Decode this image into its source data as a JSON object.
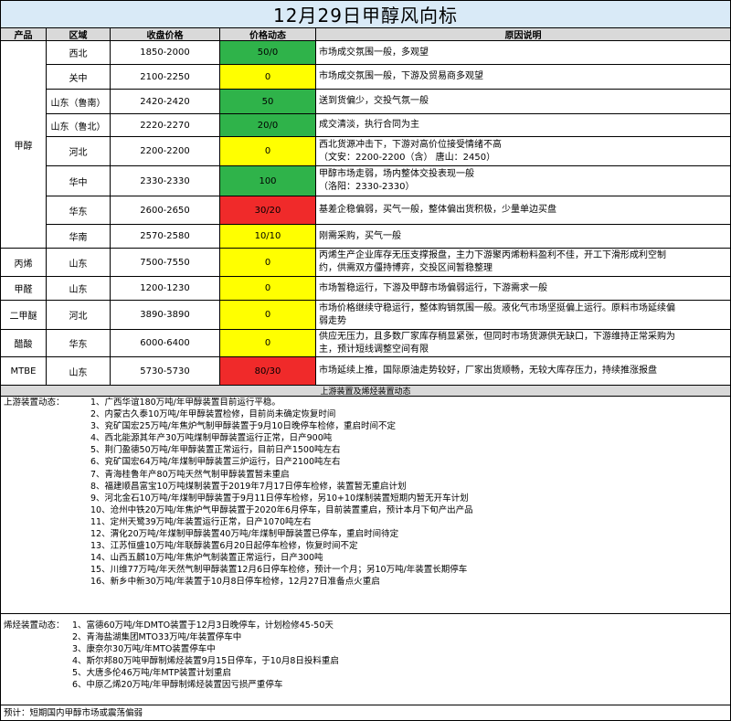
{
  "title": "12月29日甲醇风向标",
  "columns": [
    "产品",
    "区域",
    "收盘价格",
    "价格动态",
    "原因说明"
  ],
  "colors": {
    "up": "#2fb34a",
    "flat": "#ffff00",
    "down": "#f02a2a"
  },
  "rows": [
    {
      "product": "甲醇",
      "region": "西北",
      "price": "1850-2000",
      "change": "50/0",
      "status": "green",
      "reason": [
        "市场成交氛围一般，多观望"
      ]
    },
    {
      "product": "",
      "region": "关中",
      "price": "2100-2250",
      "change": "0",
      "status": "yellow",
      "reason": [
        "市场成交氛围一般，下游及贸易商多观望"
      ]
    },
    {
      "product": "",
      "region": "山东（鲁南）",
      "price": "2420-2420",
      "change": "50",
      "status": "green",
      "reason": [
        "送到货偏少，交投气氛一般"
      ]
    },
    {
      "product": "",
      "region": "山东（鲁北）",
      "price": "2220-2270",
      "change": "20/0",
      "status": "green",
      "reason": [
        "成交清淡，执行合同为主"
      ]
    },
    {
      "product": "",
      "region": "河北",
      "price": "2200-2200",
      "change": "0",
      "status": "yellow",
      "reason": [
        "西北货源冲击下，下游对高价位接受情绪不高",
        "（文安：2200-2200（含） 唐山：2450）"
      ]
    },
    {
      "product": "",
      "region": "华中",
      "price": "2330-2330",
      "change": "100",
      "status": "green",
      "reason": [
        "甲醇市场走弱，场内整体交投表现一般",
        "（洛阳：2330-2330）"
      ]
    },
    {
      "product": "",
      "region": "华东",
      "price": "2600-2650",
      "change": "30/20",
      "status": "red",
      "reason": [
        "基差企稳偏弱，买气一般，整体偏出货积极，少量单边买盘"
      ]
    },
    {
      "product": "",
      "region": "华南",
      "price": "2570-2580",
      "change": "10/10",
      "status": "yellow",
      "reason": [
        "刚需采购，买气一般"
      ]
    },
    {
      "product": "丙烯",
      "region": "山东",
      "price": "7500-7550",
      "change": "0",
      "status": "yellow",
      "reason": [
        "丙烯生产企业库存无压支撑报盘，主力下游聚丙烯粉料盈利不佳，开工下滑形成利空制",
        "约，供需双方僵持博弈，交投区间暂稳整理"
      ]
    },
    {
      "product": "甲醛",
      "region": "山东",
      "price": "1200-1230",
      "change": "0",
      "status": "yellow",
      "reason": [
        "市场暂稳运行，下游及甲醇市场偏弱运行，下游需求一般"
      ]
    },
    {
      "product": "二甲醚",
      "region": "河北",
      "price": "3890-3890",
      "change": "0",
      "status": "yellow",
      "reason": [
        "市场价格继续守稳运行，整体购销氛围一般。液化气市场坚挺偏上运行。原料市场延续偏",
        "弱走势"
      ]
    },
    {
      "product": "醋酸",
      "region": "华东",
      "price": "6000-6400",
      "change": "0",
      "status": "yellow",
      "reason": [
        "供应无压力，且多数厂家库存稍显紧张，但同时市场货源供无缺口，下游维持正常采购为",
        "主，预计短线调整空间有限"
      ]
    },
    {
      "product": "MTBE",
      "region": "山东",
      "price": "5730-5730",
      "change": "80/30",
      "status": "red",
      "reason": [
        "市场延续上推，国际原油走势较好，厂家出货顺畅，无较大库存压力，持续推涨报盘"
      ]
    }
  ],
  "section_title": "上游装置及烯烃装置动态",
  "upstream": {
    "label": "上游装置动态：",
    "items": [
      "1、广西华谊180万吨/年甲醇装置目前运行平稳。",
      "2、内蒙古久泰10万吨/年甲醇装置检修，目前尚未确定恢复时间",
      "3、兖矿国宏25万吨/年焦炉气制甲醇装置于9月10日晚停车检修，重启时间不定",
      "4、西北能源其年产30万吨煤制甲醇装置运行正常，日产900吨",
      "5、荆门盈德50万吨/年甲醇装置正常运行，目前日产1500吨左右",
      "6、兖矿国宏64万吨/年煤制甲醇装置三炉运行，日产2100吨左右",
      "7、青海桂鲁年产80万吨天然气制甲醇装置暂未重启",
      "8、福建顺昌富宝10万吨煤制装置于2019年7月17日停车检修，装置暂无重启计划",
      "9、河北金石10万吨/年煤制甲醇装置于9月11日停车检修，另10+10煤制装置短期内暂无开车计划",
      "10、沧州中铁20万吨/年焦炉气甲醇装置于2020年6月停车，目前装置重启，预计本月下旬产出产品",
      "11、定州天鹭39万吨/年装置运行正常，日产1070吨左右",
      "12、渭化20万吨/年煤制甲醇装置40万吨/年煤制甲醇装置已停车，重启时间待定",
      "13、江苏恒盛10万吨/年联醇装置6月20日起停车检修，恢复时间不定",
      "14、山西五麟10万吨/年焦炉气制装置正常运行，日产300吨",
      "15、川维77万吨/年天然气制甲醇装置12月6日停车检修，预计一个月；另10万吨/年装置长期停车",
      "16、新乡中新30万吨/年装置于10月8日停车检修，12月27日准备点火重启"
    ]
  },
  "olefin": {
    "label": "烯烃装置动态：",
    "items": [
      "1、富德60万吨/年DMTO装置于12月3日晚停车，计划检修45-50天",
      "2、青海盐湖集团MTO33万吨/年装置停车中",
      "3、康奈尔30万吨/年MTO装置停车中",
      "4、斯尔邦80万吨甲醇制烯烃装置9月15日停车，于10月8日投料重启",
      "5、大唐多伦46万吨/年MTP装置计划重启",
      "6、中原乙烯20万吨/年甲醇制烯烃装置因亏损严重停车"
    ]
  },
  "forecast": "预计：短期国内甲醇市场或震荡偏弱"
}
